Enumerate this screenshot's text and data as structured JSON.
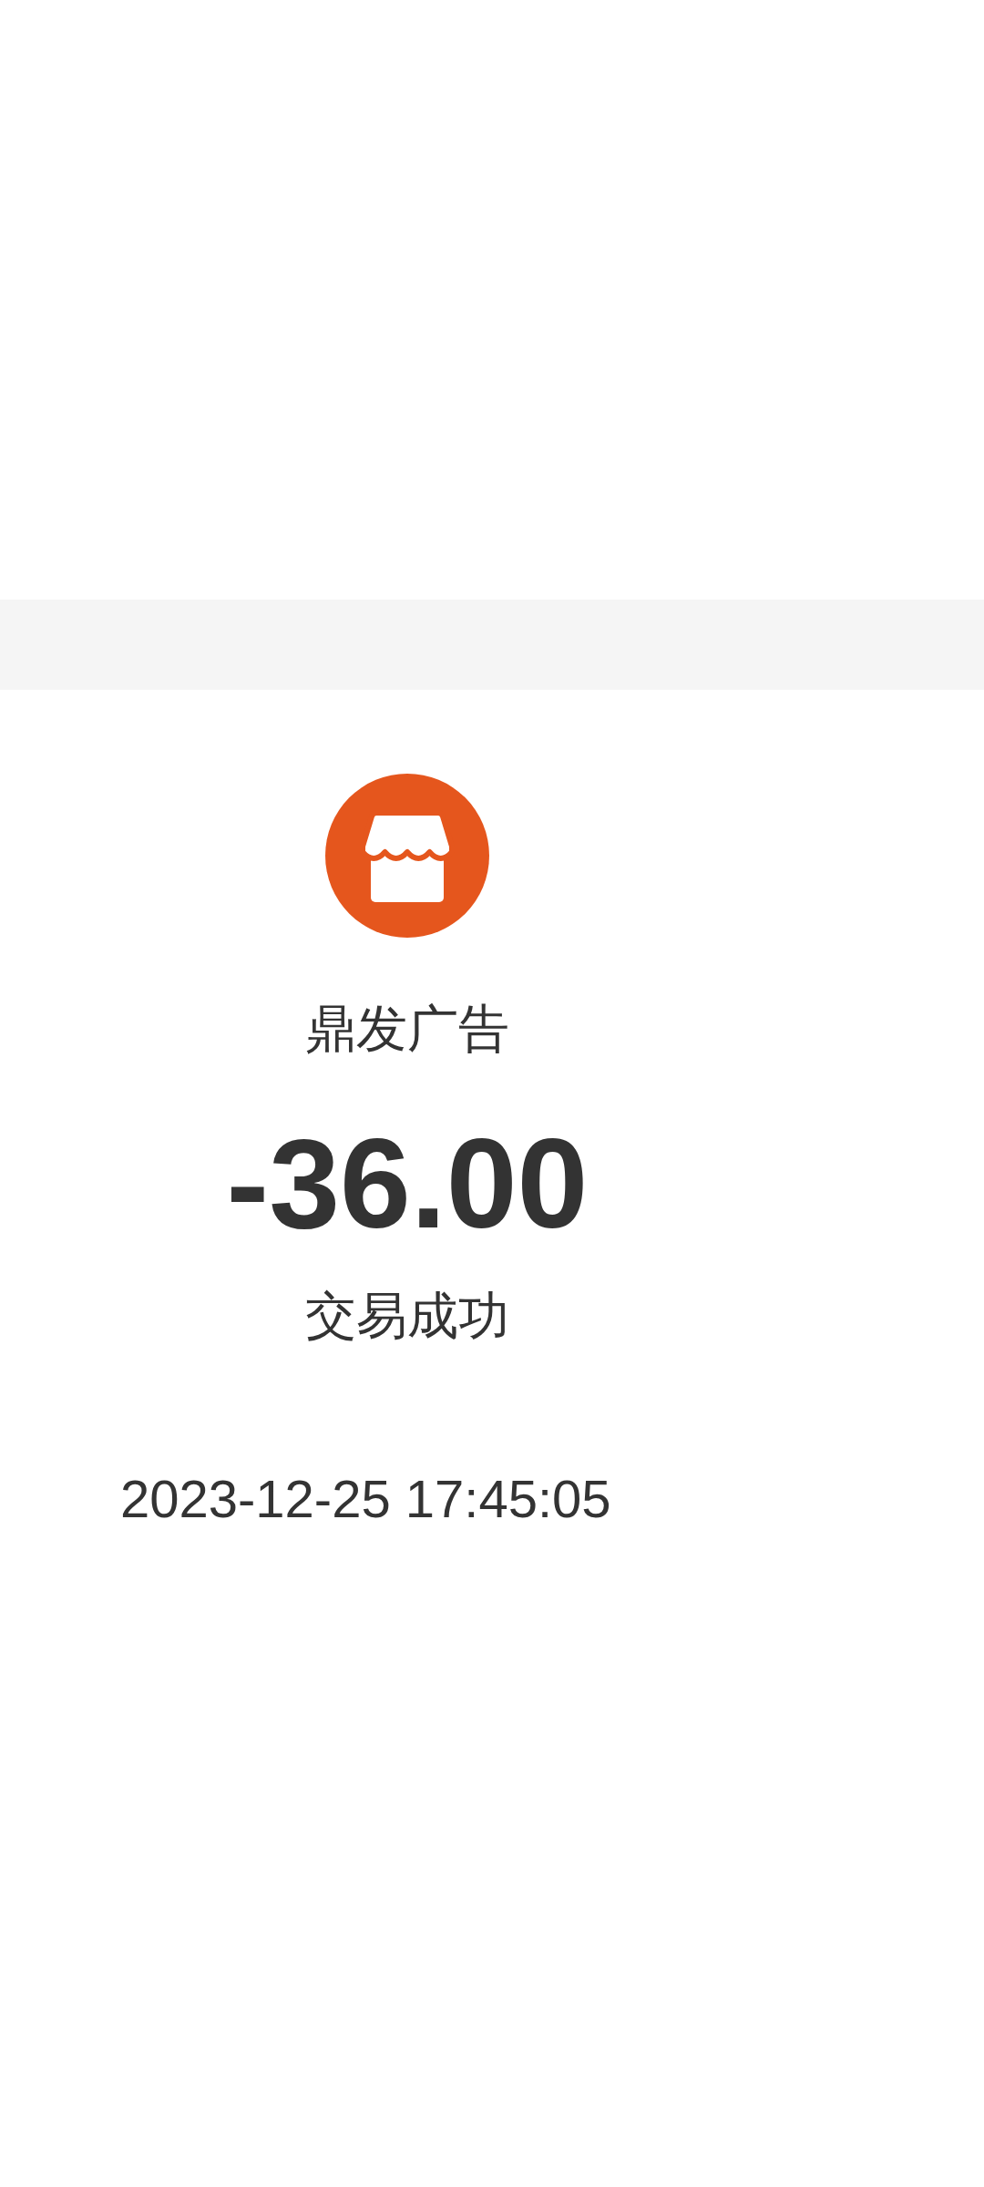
{
  "merchant": {
    "name": "鼎发广告"
  },
  "transaction": {
    "amount": "-36.00",
    "status": "交易成功",
    "time": "2023-12-25 17:45:05"
  }
}
